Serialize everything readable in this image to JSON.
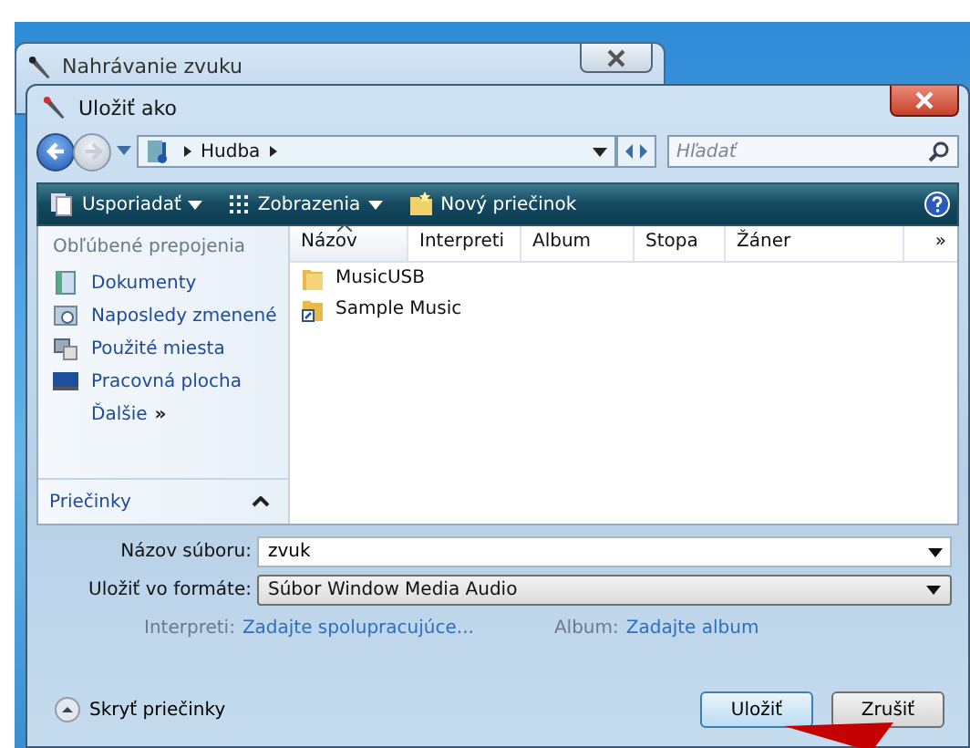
{
  "back_window": {
    "title": "Nahrávanie zvuku"
  },
  "dialog": {
    "title": "Uložiť ako"
  },
  "address": {
    "path": [
      "Hudba"
    ],
    "search_placeholder": "Hľadať"
  },
  "toolbar": [
    {
      "label": "Usporiadať",
      "kind": "organize",
      "dropdown": true
    },
    {
      "label": "Zobrazenia",
      "kind": "views",
      "dropdown": true
    },
    {
      "label": "Nový priečinok",
      "kind": "newfolder",
      "dropdown": false
    }
  ],
  "sidebar": {
    "heading": "Obľúbené prepojenia",
    "items": [
      {
        "label": "Dokumenty",
        "kind": "documents"
      },
      {
        "label": "Naposledy zmenené",
        "kind": "recent"
      },
      {
        "label": "Použité miesta",
        "kind": "places"
      },
      {
        "label": "Pracovná plocha",
        "kind": "desktop"
      }
    ],
    "more": "Ďalšie",
    "more_glyph": "»",
    "folders": "Priečinky"
  },
  "columns": [
    {
      "label": "Názov",
      "sorted": true
    },
    {
      "label": "Interpreti",
      "sorted": false
    },
    {
      "label": "Album",
      "sorted": false
    },
    {
      "label": "Stopa",
      "sorted": false
    },
    {
      "label": "Žáner",
      "sorted": false
    }
  ],
  "columns_more": "»",
  "files": [
    {
      "name": "MusicUSB",
      "kind": "folder"
    },
    {
      "name": "Sample Music",
      "kind": "shortcut"
    }
  ],
  "filename": {
    "label": "Názov súboru:",
    "value": "zvuk"
  },
  "format": {
    "label": "Uložiť vo formáte:",
    "value": "Súbor Window Media Audio"
  },
  "metadata": [
    {
      "label": "Interpreti:",
      "value": "Zadajte spolupracujúce..."
    },
    {
      "label": "Album:",
      "value": "Zadajte album"
    }
  ],
  "hide_folders": "Skryť priečinky",
  "buttons": [
    {
      "label": "Uložiť",
      "default": true
    },
    {
      "label": "Zrušiť",
      "default": false
    }
  ]
}
